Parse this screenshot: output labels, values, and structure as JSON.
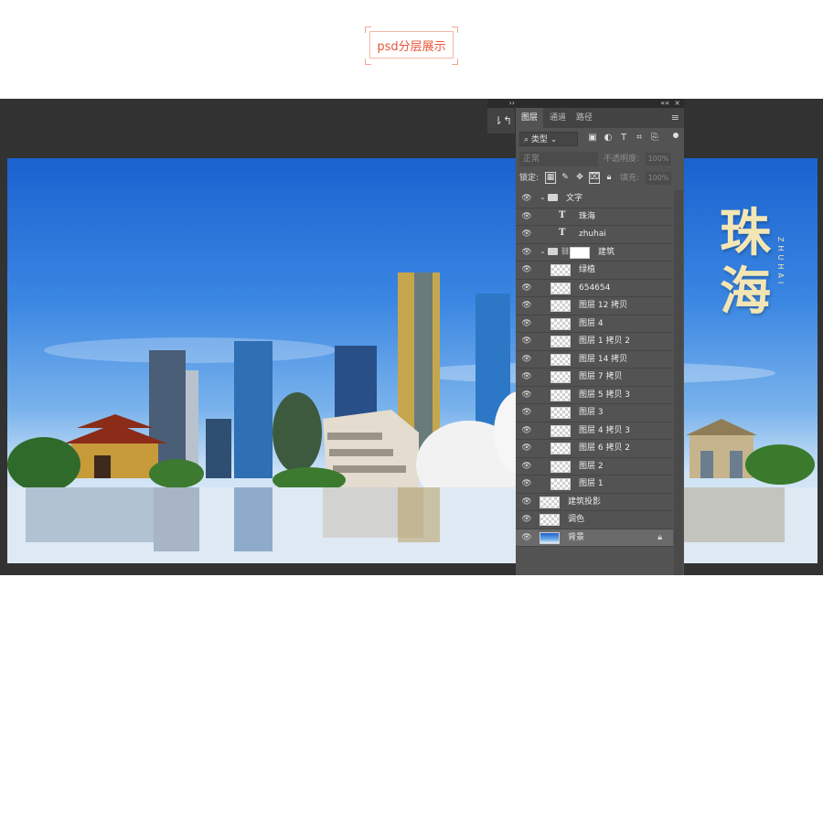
{
  "badge": {
    "label": "psd分层展示"
  },
  "toolstrip": {
    "handle": "››",
    "history_icon": "history-icon"
  },
  "artwork": {
    "title": "珠海",
    "subtitle": "ZHUHAI"
  },
  "panel": {
    "header": {
      "collapse": "««",
      "close": "×"
    },
    "tabs": [
      {
        "label": "图层",
        "active": true
      },
      {
        "label": "通道",
        "active": false
      },
      {
        "label": "路径",
        "active": false
      }
    ],
    "filter": {
      "label": "类型"
    },
    "blend": {
      "mode": "正常",
      "opacity_label": "不透明度:",
      "opacity_value": "100%"
    },
    "lock": {
      "label": "锁定:",
      "fill_label": "填充:",
      "fill_value": "100%"
    },
    "layers": [
      {
        "name": "文字",
        "kind": "group",
        "indent": 0,
        "visible": true
      },
      {
        "name": "珠海",
        "kind": "text",
        "indent": 1,
        "visible": true
      },
      {
        "name": "zhuhai",
        "kind": "text",
        "indent": 1,
        "visible": true
      },
      {
        "name": "建筑",
        "kind": "group-masked",
        "indent": 0,
        "visible": true
      },
      {
        "name": "绿植",
        "kind": "pixel",
        "indent": 1,
        "visible": true
      },
      {
        "name": "654654",
        "kind": "pixel",
        "indent": 1,
        "visible": true
      },
      {
        "name": "图层 12 拷贝",
        "kind": "pixel",
        "indent": 1,
        "visible": true
      },
      {
        "name": "图层 4",
        "kind": "pixel",
        "indent": 1,
        "visible": true
      },
      {
        "name": "图层 1 拷贝 2",
        "kind": "pixel",
        "indent": 1,
        "visible": true
      },
      {
        "name": "图层 14 拷贝",
        "kind": "pixel",
        "indent": 1,
        "visible": true
      },
      {
        "name": "图层 7 拷贝",
        "kind": "pixel",
        "indent": 1,
        "visible": true
      },
      {
        "name": "图层 5 拷贝 3",
        "kind": "pixel",
        "indent": 1,
        "visible": true
      },
      {
        "name": "图层 3",
        "kind": "pixel",
        "indent": 1,
        "visible": true
      },
      {
        "name": "图层 4 拷贝 3",
        "kind": "pixel",
        "indent": 1,
        "visible": true
      },
      {
        "name": "图层 6 拷贝 2",
        "kind": "pixel",
        "indent": 1,
        "visible": true
      },
      {
        "name": "图层 2",
        "kind": "pixel",
        "indent": 1,
        "visible": true
      },
      {
        "name": "图层 1",
        "kind": "pixel",
        "indent": 1,
        "visible": true
      },
      {
        "name": "建筑投影",
        "kind": "pixel",
        "indent": 0,
        "visible": true
      },
      {
        "name": "调色",
        "kind": "pixel",
        "indent": 0,
        "visible": true
      },
      {
        "name": "背景",
        "kind": "background",
        "indent": 0,
        "visible": true,
        "locked": true,
        "selected": true
      }
    ]
  }
}
